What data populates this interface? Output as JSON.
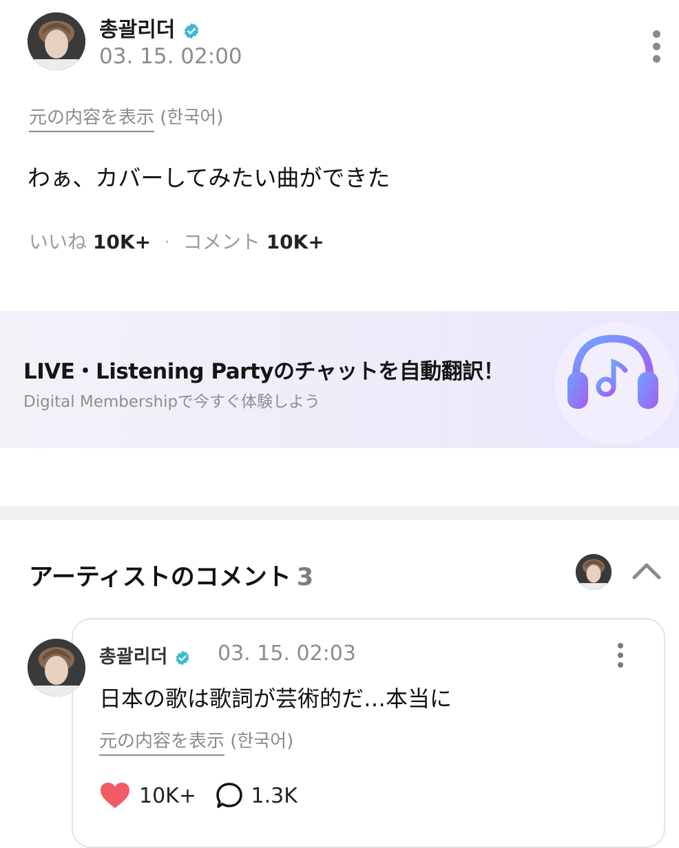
{
  "post": {
    "author": "총괄리더",
    "verified_icon": "verified-badge-icon",
    "timestamp": "03. 15. 02:00",
    "translate_link": "元の内容を表示",
    "translate_lang": "(한국어)",
    "body": "わぁ、カバーしてみたい曲ができた",
    "likes_label": "いいね",
    "likes_count": "10K+",
    "separator": "·",
    "comments_label": "コメント",
    "comments_count": "10K+"
  },
  "banner": {
    "title": "LIVE・Listening Partyのチャットを自動翻訳！",
    "subtitle": "Digital Membershipで今すぐ体験しよう",
    "icon": "headphones-music-icon",
    "accent": "#8e6ff0"
  },
  "artist_comments": {
    "title": "アーティストのコメント",
    "count": "3",
    "collapse_icon": "chevron-up-icon",
    "items": [
      {
        "author": "총괄리더",
        "timestamp": "03. 15. 02:03",
        "body": "日本の歌は歌詞が芸術的だ…本当に",
        "translate_link": "元の内容を表示",
        "translate_lang": "(한국어)",
        "likes": "10K+",
        "replies": "1.3K"
      }
    ]
  },
  "colors": {
    "verified": "#3bb9d4",
    "heart": "#f15b63",
    "muted_text": "#8c8c8c"
  }
}
